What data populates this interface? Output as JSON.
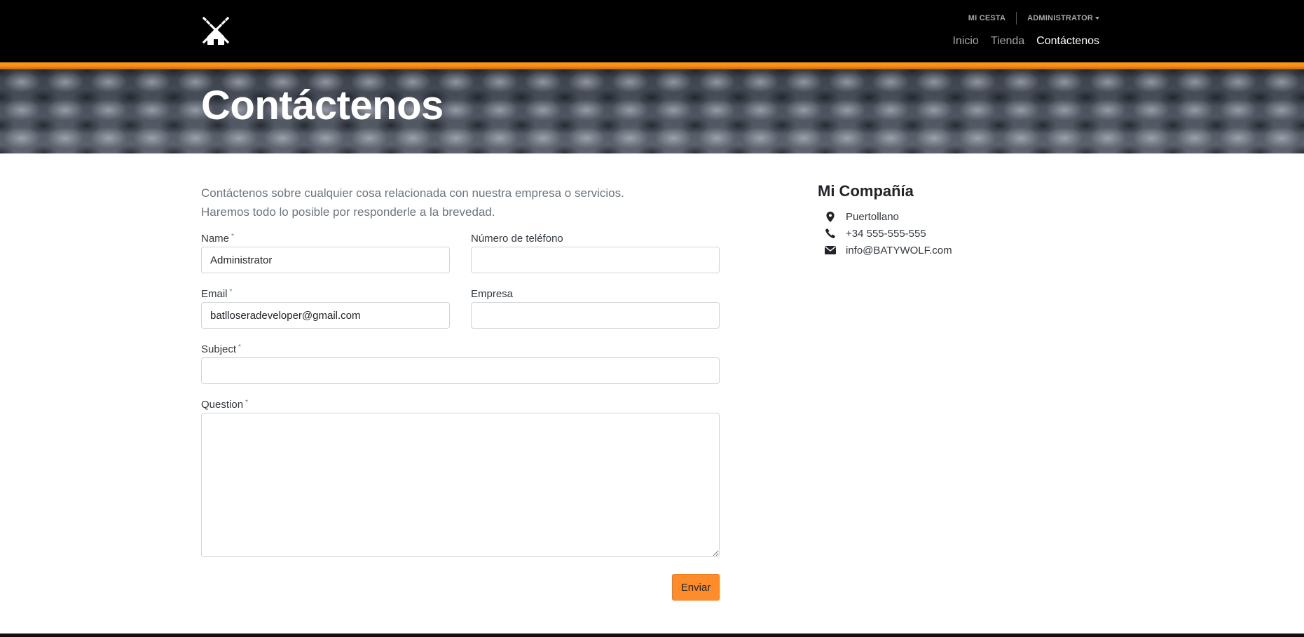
{
  "header": {
    "logo_icon": "windmill-icon",
    "util_nav": {
      "cart_label": "MI CESTA",
      "user_label": "ADMINISTRATOR"
    },
    "main_nav": [
      {
        "label": "Inicio",
        "active": false
      },
      {
        "label": "Tienda",
        "active": false
      },
      {
        "label": "Contáctenos",
        "active": true
      }
    ],
    "accent_color": "#ff8c1a"
  },
  "banner": {
    "title": "Contáctenos"
  },
  "intro": {
    "line1": "Contáctenos sobre cualquier cosa relacionada con nuestra empresa o servicios.",
    "line2": "Haremos todo lo posible por responderle a la brevedad."
  },
  "form": {
    "name": {
      "label": "Name",
      "required": "*",
      "value": "Administrator"
    },
    "phone": {
      "label": "Número de teléfono",
      "value": ""
    },
    "email": {
      "label": "Email",
      "required": "*",
      "value": "batlloseradeveloper@gmail.com"
    },
    "company": {
      "label": "Empresa",
      "value": ""
    },
    "subject": {
      "label": "Subject",
      "required": "*",
      "value": ""
    },
    "question": {
      "label": "Question",
      "required": "*",
      "value": ""
    },
    "submit_label": "Enviar",
    "submit_color": "#ff8c2a"
  },
  "company_info": {
    "title": "Mi Compañía",
    "items": [
      {
        "icon": "map-marker-icon",
        "text": "Puertollano"
      },
      {
        "icon": "phone-icon",
        "text": "+34 555-555-555"
      },
      {
        "icon": "envelope-icon",
        "text": "info@BATYWOLF.com"
      }
    ]
  }
}
